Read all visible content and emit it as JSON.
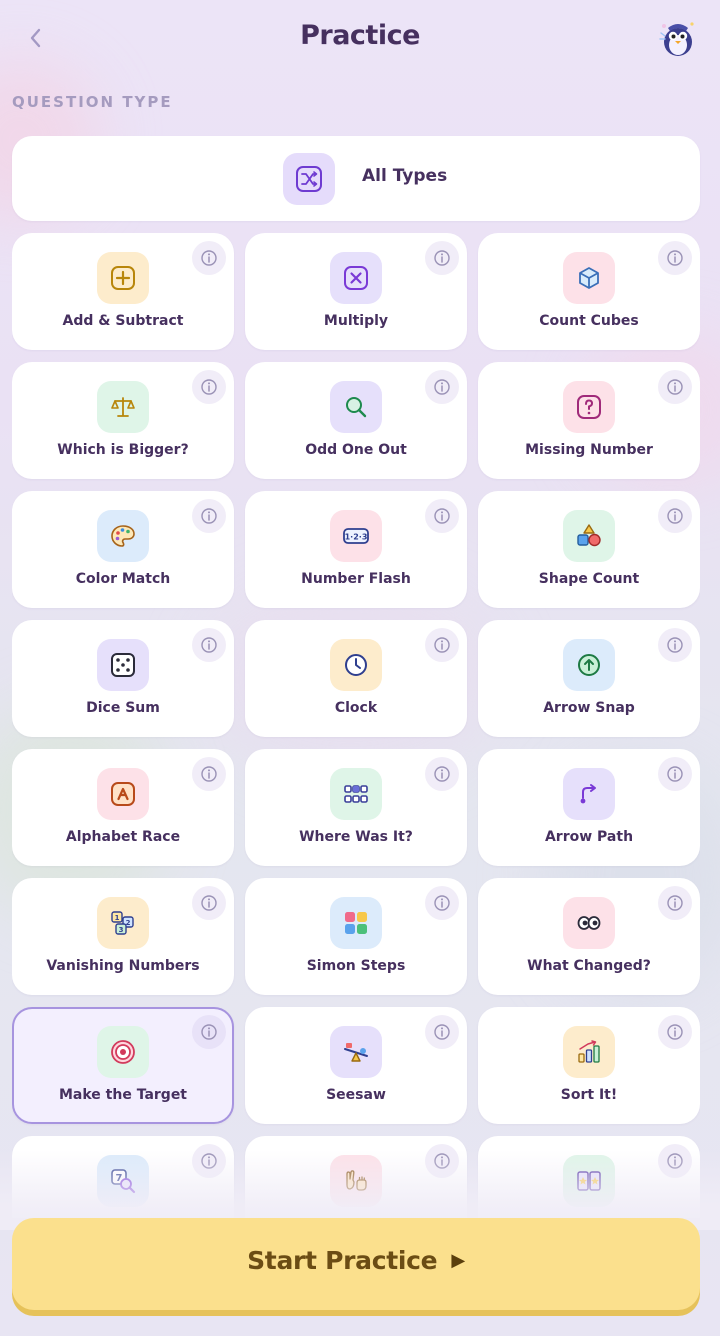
{
  "header": {
    "back_icon": "chevron-left-icon",
    "title": "Practice",
    "mascot_icon": "penguin-mascot-icon"
  },
  "section": {
    "label": "QUESTION TYPE"
  },
  "all_types": {
    "label": "All Types",
    "icon": "shuffle-icon",
    "icon_bg": "#e5dcfb"
  },
  "cards": [
    {
      "label": "Add & Subtract",
      "icon": "plus-box-icon",
      "bg": "#fdeccc"
    },
    {
      "label": "Multiply",
      "icon": "multiply-box-icon",
      "bg": "#e6e0fb"
    },
    {
      "label": "Count Cubes",
      "icon": "cube-icon",
      "bg": "#fde1e8"
    },
    {
      "label": "Which is Bigger?",
      "icon": "scale-icon",
      "bg": "#dff5e8"
    },
    {
      "label": "Odd One Out",
      "icon": "magnifier-icon",
      "bg": "#e6e0fb"
    },
    {
      "label": "Missing Number",
      "icon": "question-box-icon",
      "bg": "#fde1e8"
    },
    {
      "label": "Color Match",
      "icon": "palette-icon",
      "bg": "#dcebfb"
    },
    {
      "label": "Number Flash",
      "icon": "number-sequence-icon",
      "bg": "#fde1e8"
    },
    {
      "label": "Shape Count",
      "icon": "shapes-icon",
      "bg": "#dff5e8"
    },
    {
      "label": "Dice Sum",
      "icon": "dice-icon",
      "bg": "#e6e0fb"
    },
    {
      "label": "Clock",
      "icon": "clock-icon",
      "bg": "#fdeccc"
    },
    {
      "label": "Arrow Snap",
      "icon": "arrow-up-circle-icon",
      "bg": "#dcebfb"
    },
    {
      "label": "Alphabet Race",
      "icon": "letter-a-icon",
      "bg": "#fde1e8"
    },
    {
      "label": "Where Was It?",
      "icon": "grid-dots-icon",
      "bg": "#dff5e8"
    },
    {
      "label": "Arrow Path",
      "icon": "path-arrow-icon",
      "bg": "#e6e0fb"
    },
    {
      "label": "Vanishing Numbers",
      "icon": "number-blocks-icon",
      "bg": "#fdeccc"
    },
    {
      "label": "Simon Steps",
      "icon": "color-grid-icon",
      "bg": "#dcebfb"
    },
    {
      "label": "What Changed?",
      "icon": "eyes-icon",
      "bg": "#fde1e8"
    },
    {
      "label": "Make the Target",
      "icon": "target-icon",
      "bg": "#dff5e8",
      "selected": true
    },
    {
      "label": "Seesaw",
      "icon": "seesaw-icon",
      "bg": "#e6e0fb"
    },
    {
      "label": "Sort It!",
      "icon": "bar-sort-icon",
      "bg": "#fdeccc"
    },
    {
      "label": "",
      "icon": "number-search-icon",
      "bg": "#dcebfb"
    },
    {
      "label": "",
      "icon": "hand-gesture-icon",
      "bg": "#fde1e8"
    },
    {
      "label": "",
      "icon": "star-cards-icon",
      "bg": "#dff5e8"
    }
  ],
  "info_icon": "info-icon",
  "start_button": {
    "label": "Start Practice",
    "icon": "play-icon",
    "play_glyph": "▶"
  },
  "colors": {
    "title": "#46305f",
    "accent": "#a794df",
    "start_bg": "#fbe08d",
    "start_text": "#6b4d14"
  }
}
